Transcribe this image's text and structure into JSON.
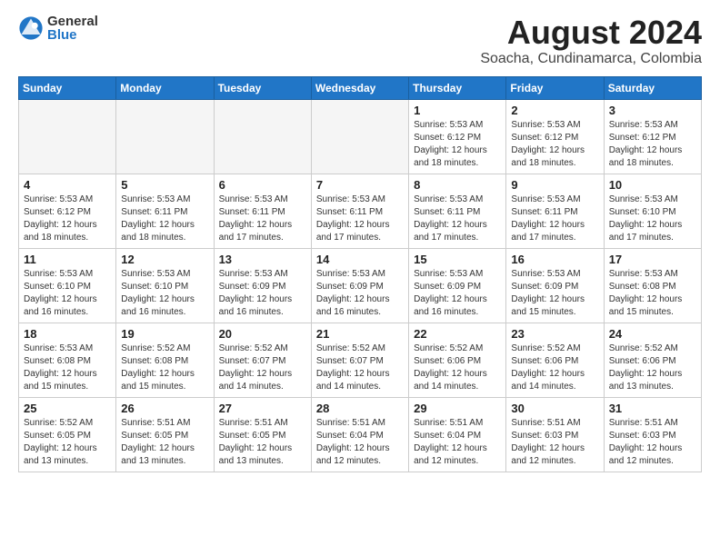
{
  "logo": {
    "general": "General",
    "blue": "Blue"
  },
  "title": "August 2024",
  "location": "Soacha, Cundinamarca, Colombia",
  "days_of_week": [
    "Sunday",
    "Monday",
    "Tuesday",
    "Wednesday",
    "Thursday",
    "Friday",
    "Saturday"
  ],
  "weeks": [
    [
      {
        "day": "",
        "info": ""
      },
      {
        "day": "",
        "info": ""
      },
      {
        "day": "",
        "info": ""
      },
      {
        "day": "",
        "info": ""
      },
      {
        "day": "1",
        "info": "Sunrise: 5:53 AM\nSunset: 6:12 PM\nDaylight: 12 hours\nand 18 minutes."
      },
      {
        "day": "2",
        "info": "Sunrise: 5:53 AM\nSunset: 6:12 PM\nDaylight: 12 hours\nand 18 minutes."
      },
      {
        "day": "3",
        "info": "Sunrise: 5:53 AM\nSunset: 6:12 PM\nDaylight: 12 hours\nand 18 minutes."
      }
    ],
    [
      {
        "day": "4",
        "info": "Sunrise: 5:53 AM\nSunset: 6:12 PM\nDaylight: 12 hours\nand 18 minutes."
      },
      {
        "day": "5",
        "info": "Sunrise: 5:53 AM\nSunset: 6:11 PM\nDaylight: 12 hours\nand 18 minutes."
      },
      {
        "day": "6",
        "info": "Sunrise: 5:53 AM\nSunset: 6:11 PM\nDaylight: 12 hours\nand 17 minutes."
      },
      {
        "day": "7",
        "info": "Sunrise: 5:53 AM\nSunset: 6:11 PM\nDaylight: 12 hours\nand 17 minutes."
      },
      {
        "day": "8",
        "info": "Sunrise: 5:53 AM\nSunset: 6:11 PM\nDaylight: 12 hours\nand 17 minutes."
      },
      {
        "day": "9",
        "info": "Sunrise: 5:53 AM\nSunset: 6:11 PM\nDaylight: 12 hours\nand 17 minutes."
      },
      {
        "day": "10",
        "info": "Sunrise: 5:53 AM\nSunset: 6:10 PM\nDaylight: 12 hours\nand 17 minutes."
      }
    ],
    [
      {
        "day": "11",
        "info": "Sunrise: 5:53 AM\nSunset: 6:10 PM\nDaylight: 12 hours\nand 16 minutes."
      },
      {
        "day": "12",
        "info": "Sunrise: 5:53 AM\nSunset: 6:10 PM\nDaylight: 12 hours\nand 16 minutes."
      },
      {
        "day": "13",
        "info": "Sunrise: 5:53 AM\nSunset: 6:09 PM\nDaylight: 12 hours\nand 16 minutes."
      },
      {
        "day": "14",
        "info": "Sunrise: 5:53 AM\nSunset: 6:09 PM\nDaylight: 12 hours\nand 16 minutes."
      },
      {
        "day": "15",
        "info": "Sunrise: 5:53 AM\nSunset: 6:09 PM\nDaylight: 12 hours\nand 16 minutes."
      },
      {
        "day": "16",
        "info": "Sunrise: 5:53 AM\nSunset: 6:09 PM\nDaylight: 12 hours\nand 15 minutes."
      },
      {
        "day": "17",
        "info": "Sunrise: 5:53 AM\nSunset: 6:08 PM\nDaylight: 12 hours\nand 15 minutes."
      }
    ],
    [
      {
        "day": "18",
        "info": "Sunrise: 5:53 AM\nSunset: 6:08 PM\nDaylight: 12 hours\nand 15 minutes."
      },
      {
        "day": "19",
        "info": "Sunrise: 5:52 AM\nSunset: 6:08 PM\nDaylight: 12 hours\nand 15 minutes."
      },
      {
        "day": "20",
        "info": "Sunrise: 5:52 AM\nSunset: 6:07 PM\nDaylight: 12 hours\nand 14 minutes."
      },
      {
        "day": "21",
        "info": "Sunrise: 5:52 AM\nSunset: 6:07 PM\nDaylight: 12 hours\nand 14 minutes."
      },
      {
        "day": "22",
        "info": "Sunrise: 5:52 AM\nSunset: 6:06 PM\nDaylight: 12 hours\nand 14 minutes."
      },
      {
        "day": "23",
        "info": "Sunrise: 5:52 AM\nSunset: 6:06 PM\nDaylight: 12 hours\nand 14 minutes."
      },
      {
        "day": "24",
        "info": "Sunrise: 5:52 AM\nSunset: 6:06 PM\nDaylight: 12 hours\nand 13 minutes."
      }
    ],
    [
      {
        "day": "25",
        "info": "Sunrise: 5:52 AM\nSunset: 6:05 PM\nDaylight: 12 hours\nand 13 minutes."
      },
      {
        "day": "26",
        "info": "Sunrise: 5:51 AM\nSunset: 6:05 PM\nDaylight: 12 hours\nand 13 minutes."
      },
      {
        "day": "27",
        "info": "Sunrise: 5:51 AM\nSunset: 6:05 PM\nDaylight: 12 hours\nand 13 minutes."
      },
      {
        "day": "28",
        "info": "Sunrise: 5:51 AM\nSunset: 6:04 PM\nDaylight: 12 hours\nand 12 minutes."
      },
      {
        "day": "29",
        "info": "Sunrise: 5:51 AM\nSunset: 6:04 PM\nDaylight: 12 hours\nand 12 minutes."
      },
      {
        "day": "30",
        "info": "Sunrise: 5:51 AM\nSunset: 6:03 PM\nDaylight: 12 hours\nand 12 minutes."
      },
      {
        "day": "31",
        "info": "Sunrise: 5:51 AM\nSunset: 6:03 PM\nDaylight: 12 hours\nand 12 minutes."
      }
    ]
  ]
}
